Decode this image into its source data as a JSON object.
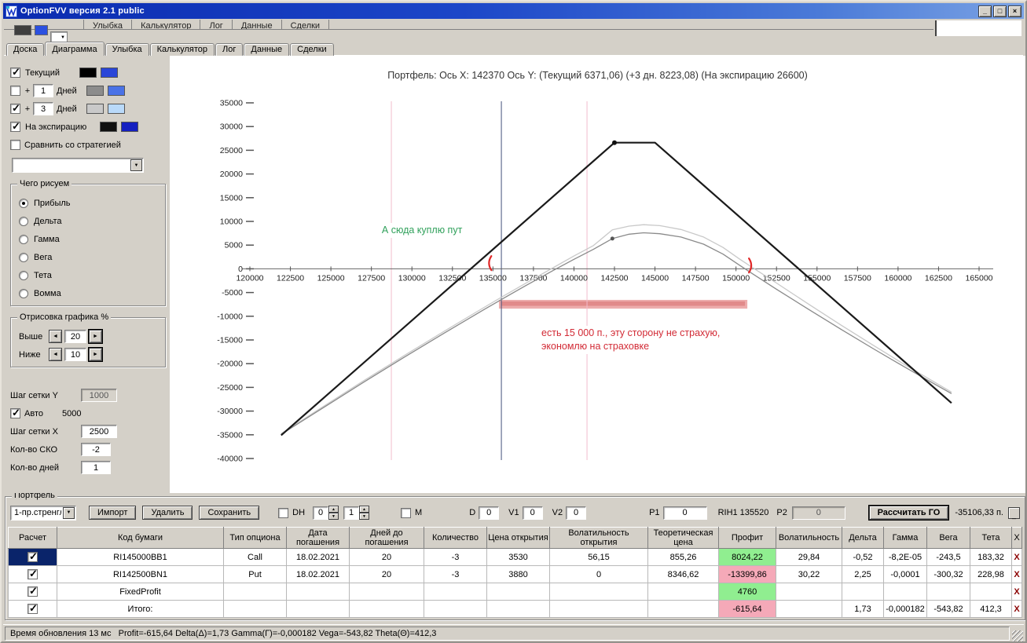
{
  "window": {
    "title": "OptionFVV версия 2.1 public",
    "minimize": "_",
    "maximize": "□",
    "close": "×"
  },
  "icons": {
    "combo_arrow": "▼",
    "spin_up": "▲",
    "spin_down": "▼",
    "left_arrow": "◄",
    "right_arrow": "►",
    "app_glyph": "W"
  },
  "top_partial": {
    "tabs": [
      "Улыбка",
      "Калькулятор",
      "Лог",
      "Данные",
      "Сделки"
    ],
    "swatch_colors": [
      "#3f3f3f",
      "#2b50e0"
    ]
  },
  "tabs": {
    "items": [
      "Доска",
      "Диаграмма",
      "Улыбка",
      "Калькулятор",
      "Лог",
      "Данные",
      "Сделки"
    ],
    "active": "Диаграмма"
  },
  "left_panel": {
    "curves": [
      {
        "checked": "true",
        "label": "Текущий",
        "colors": [
          "#000000",
          "#2a46d8"
        ]
      },
      {
        "checked": "false",
        "prefix": "+",
        "value": "1",
        "suffix": "Дней",
        "colors": [
          "#8c8c8c",
          "#4a72e6"
        ]
      },
      {
        "checked": "true",
        "prefix": "+",
        "value": "3",
        "suffix": "Дней",
        "colors": [
          "#c9c9c9",
          "#b9d9f9"
        ]
      },
      {
        "checked": "true",
        "label": "На экспирацию",
        "colors": [
          "#101010",
          "#1520c0"
        ]
      }
    ],
    "compare": {
      "checked": "false",
      "label": "Сравнить со стратегией"
    },
    "strategy_combo_value": "",
    "draw_group": {
      "title": "Чего рисуем",
      "options": [
        "Прибыль",
        "Дельта",
        "Гамма",
        "Вега",
        "Тета",
        "Вомма"
      ],
      "selected": "Прибыль"
    },
    "range_group": {
      "title": "Отрисовка графика %",
      "rows": [
        {
          "label": "Выше",
          "value": "20"
        },
        {
          "label": "Ниже",
          "value": "10"
        }
      ]
    },
    "grid_y": {
      "label": "Шаг сетки Y",
      "value": "1000"
    },
    "auto": {
      "checked": "true",
      "label": "Авто",
      "value": "5000"
    },
    "grid_x": {
      "label": "Шаг сетки X",
      "value": "2500"
    },
    "sko": {
      "label": "Кол-во СКО",
      "value": "-2"
    },
    "days": {
      "label": "Кол-во дней",
      "value": "1"
    }
  },
  "chart_data": {
    "type": "line",
    "title": "Портфель:  Ось X: 142370  Ось Y:  (Текущий 6371,06)  (+3 дн. 8223,08)  (На экспирацию 26600)",
    "x_range": [
      120000,
      165000
    ],
    "y_range": [
      35000,
      -40000
    ],
    "x_ticks": [
      120000,
      122500,
      125000,
      127500,
      130000,
      132500,
      135000,
      137500,
      140000,
      142500,
      145000,
      147500,
      150000,
      152500,
      155000,
      157500,
      160000,
      162500,
      165000
    ],
    "y_ticks": [
      35000,
      30000,
      25000,
      20000,
      15000,
      10000,
      5000,
      0,
      -5000,
      -10000,
      -15000,
      -20000,
      -25000,
      -30000,
      -35000,
      -40000
    ],
    "series": [
      {
        "name": "+3 Дней",
        "color": "#c9c9c9",
        "width": 1.3,
        "points": [
          [
            121932,
            -34750
          ],
          [
            124500,
            -29100
          ],
          [
            127000,
            -23650
          ],
          [
            129500,
            -18350
          ],
          [
            132000,
            -13150
          ],
          [
            134500,
            -8050
          ],
          [
            135520,
            -6000
          ],
          [
            137000,
            -3100
          ],
          [
            138800,
            400
          ],
          [
            140000,
            2700
          ],
          [
            141200,
            4900
          ],
          [
            142370,
            8223
          ],
          [
            143400,
            9000
          ],
          [
            144300,
            9300
          ],
          [
            145300,
            9100
          ],
          [
            146600,
            8300
          ],
          [
            148000,
            6700
          ],
          [
            149200,
            4500
          ],
          [
            150200,
            2100
          ],
          [
            151000,
            300
          ],
          [
            152500,
            -3000
          ],
          [
            154500,
            -7500
          ],
          [
            156500,
            -11900
          ],
          [
            158500,
            -16200
          ],
          [
            160500,
            -20400
          ],
          [
            162000,
            -23400
          ],
          [
            163300,
            -26000
          ]
        ]
      },
      {
        "name": "Текущий",
        "color": "#8a8a8a",
        "width": 1.3,
        "points": [
          [
            121932,
            -34900
          ],
          [
            124500,
            -29350
          ],
          [
            127000,
            -23950
          ],
          [
            129500,
            -18700
          ],
          [
            132000,
            -13550
          ],
          [
            134500,
            -8500
          ],
          [
            135520,
            -6470
          ],
          [
            137000,
            -3600
          ],
          [
            138800,
            -200
          ],
          [
            140000,
            2000
          ],
          [
            141200,
            4100
          ],
          [
            142370,
            6371
          ],
          [
            143400,
            7300
          ],
          [
            144300,
            7600
          ],
          [
            145300,
            7400
          ],
          [
            146600,
            6700
          ],
          [
            148000,
            5200
          ],
          [
            149200,
            3100
          ],
          [
            150200,
            800
          ],
          [
            151000,
            -1000
          ],
          [
            152500,
            -4300
          ],
          [
            154500,
            -8600
          ],
          [
            156500,
            -12800
          ],
          [
            158500,
            -16900
          ],
          [
            160500,
            -20900
          ],
          [
            162000,
            -23800
          ],
          [
            163300,
            -26300
          ]
        ]
      },
      {
        "name": "На экспирацию",
        "color": "#1a1a1a",
        "width": 2.2,
        "points": [
          [
            121932,
            -35106
          ],
          [
            142500,
            26600
          ],
          [
            145000,
            26600
          ],
          [
            163300,
            -28300
          ]
        ]
      }
    ],
    "markers": [
      {
        "x": 142500,
        "y": 26600,
        "r": 3,
        "color": "#111111"
      },
      {
        "x": 142370,
        "y": 6371,
        "r": 2.5,
        "color": "#555555"
      }
    ],
    "vlines": [
      {
        "x": 135520,
        "color": "#44507a"
      },
      {
        "x": 128730,
        "color": "#f2bccc"
      },
      {
        "x": 140805,
        "color": "#f2bccc"
      }
    ],
    "band": {
      "x1": 135370,
      "x2": 150700,
      "y1": -6550,
      "y2": -8400,
      "color": "rgba(219,90,90,0.5)"
    },
    "risk_marks": [
      {
        "x": 135000,
        "y": 1200,
        "side": "left"
      },
      {
        "x": 150700,
        "y": 700,
        "side": "right"
      }
    ],
    "annotations": [
      {
        "text": "А сюда куплю пут",
        "x": 127900,
        "y": 9700,
        "color": "#2fa05a"
      },
      {
        "lines": [
          "есть 15 000 п., эту сторону не страхую,",
          "экономлю на страховке"
        ],
        "x": 137750,
        "y": -12100,
        "color": "#d22a35"
      }
    ]
  },
  "portfolio": {
    "group_title": "Портфель",
    "preset": "1-пр.стренгл",
    "import_btn": "Импорт",
    "delete_btn": "Удалить",
    "save_btn": "Сохранить",
    "dh": {
      "checked": "false",
      "label": "DH",
      "spin1": "0",
      "spin2": "1"
    },
    "m": {
      "checked": "false",
      "label": "M"
    },
    "fields": [
      {
        "label": "D",
        "value": "0"
      },
      {
        "label": "V1",
        "value": "0"
      },
      {
        "label": "V2",
        "value": "0"
      },
      {
        "label": "P1",
        "value": "0"
      }
    ],
    "ticker": "RIH1 135520",
    "p2": {
      "label": "P2",
      "value": "0"
    },
    "calc_btn": "Рассчитать ГО",
    "margin": "-35106,33 п.",
    "collapse": "_",
    "table": {
      "columns": [
        "Расчет",
        "Код бумаги",
        "Тип опциона",
        "Дата погашения",
        "Дней до погашения",
        "Количество",
        "Цена открытия",
        "Волатильность открытия",
        "Теоретическая цена",
        "Профит",
        "Волатильность",
        "Дельта",
        "Гамма",
        "Вега",
        "Тета",
        "X"
      ],
      "rows": [
        {
          "checked": "true",
          "sel": true,
          "code": "RI145000BB1",
          "type": "Call",
          "date": "18.02.2021",
          "days": "20",
          "qty": "-3",
          "open_price": "3530",
          "open_vol": "56,15",
          "theor": "855,26",
          "profit": "8024,22",
          "profit_cls": "pos",
          "vol": "29,84",
          "delta": "-0,52",
          "gamma": "-8,2E-05",
          "vega": "-243,5",
          "theta": "183,32",
          "del": "X"
        },
        {
          "checked": "true",
          "sel": false,
          "code": "RI142500BN1",
          "type": "Put",
          "date": "18.02.2021",
          "days": "20",
          "qty": "-3",
          "open_price": "3880",
          "open_vol": "0",
          "theor": "8346,62",
          "profit": "-13399,86",
          "profit_cls": "neg",
          "vol": "30,22",
          "delta": "2,25",
          "gamma": "-0,0001",
          "vega": "-300,32",
          "theta": "228,98",
          "del": "X"
        },
        {
          "checked": "true",
          "sel": false,
          "code": "FixedProfit",
          "type": "",
          "date": "",
          "days": "",
          "qty": "",
          "open_price": "",
          "open_vol": "",
          "theor": "",
          "profit": "4760",
          "profit_cls": "pos",
          "vol": "",
          "delta": "",
          "gamma": "",
          "vega": "",
          "theta": "",
          "del": "X"
        },
        {
          "checked": "true",
          "sel": false,
          "code": "Итого:",
          "type": "",
          "date": "",
          "days": "",
          "qty": "",
          "open_price": "",
          "open_vol": "",
          "theor": "",
          "profit": "-615,64",
          "profit_cls": "neg",
          "vol": "",
          "delta": "1,73",
          "gamma": "-0,000182",
          "vega": "-543,82",
          "theta": "412,3",
          "del": "X"
        }
      ]
    }
  },
  "statusbar": {
    "text": "Время обновления 13 мс   Profit=-615,64 Delta(Δ)=1,73 Gamma(Г)=-0,000182 Vega=-543,82 Theta(Θ)=412,3"
  }
}
